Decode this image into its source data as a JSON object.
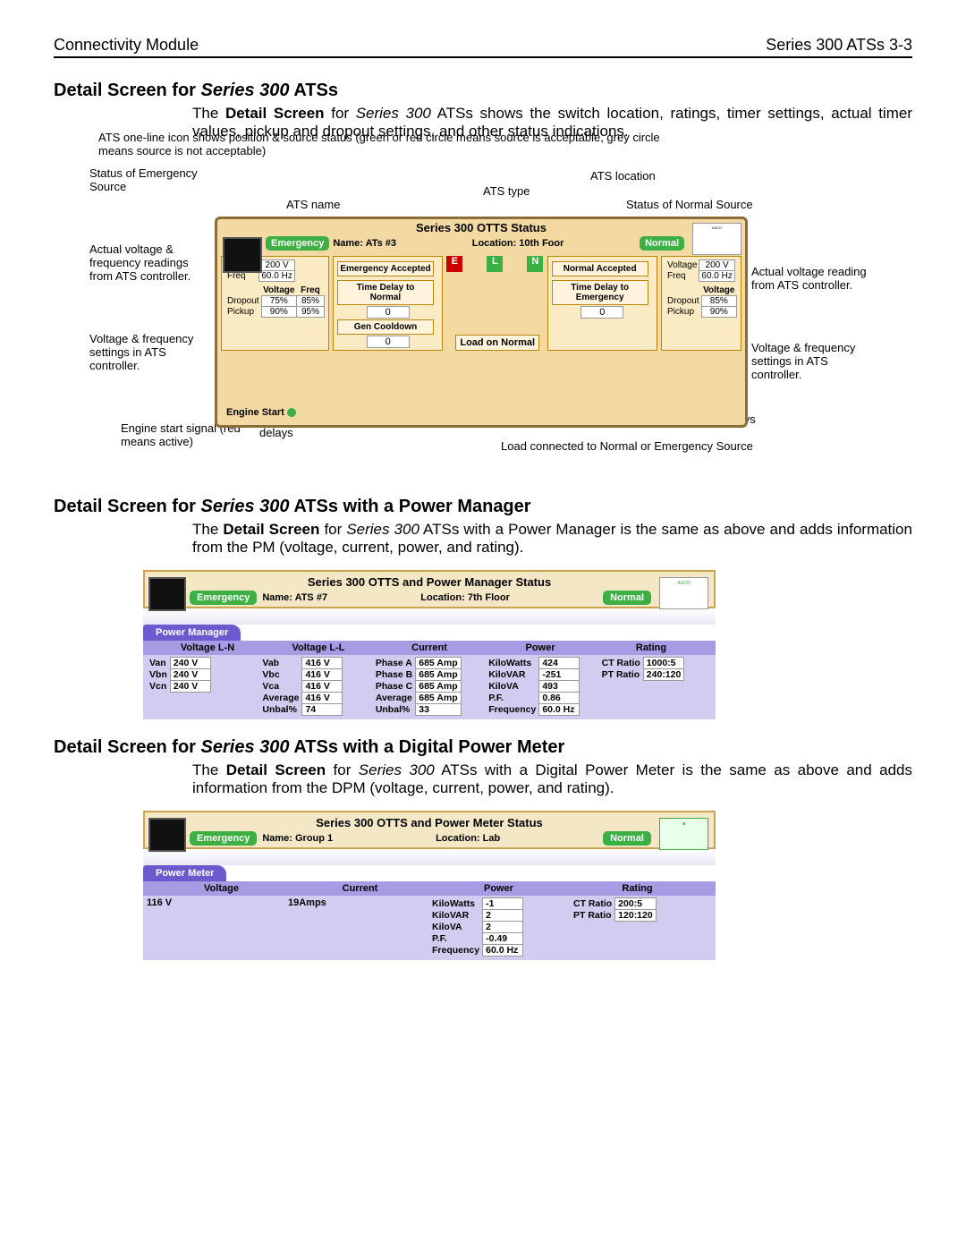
{
  "header": {
    "left": "Connectivity Module",
    "right": "Series 300 ATSs    3-3"
  },
  "section1": {
    "heading_a": "Detail Screen for ",
    "heading_b_ital": "Series 300",
    "heading_c": " ATSs",
    "para_a": "The ",
    "para_b_bold": "Detail Screen",
    "para_c": " for ",
    "para_d_ital": "Series 300",
    "para_e": " ATSs shows the switch location, ratings, timer settings, actual timer values, pickup and dropout settings, and other status indications."
  },
  "fig1": {
    "note_top": "ATS one-line icon shows position & source status (green or red circle means source is acceptable, grey circle means source is not acceptable)",
    "lbl_emergency_status": "Status of Emergency Source",
    "lbl_ats_name": "ATS name",
    "lbl_ats_type": "ATS type",
    "lbl_ats_location": "ATS location",
    "lbl_normal_status": "Status of Normal Source",
    "lbl_actual_vf_left": "Actual voltage & frequency readings from ATS controller.",
    "lbl_actual_vf_right": "Actual voltage reading from ATS controller.",
    "lbl_vf_settings_left": "Voltage & frequency settings in ATS controller.",
    "lbl_vf_settings_right": "Voltage & frequency settings in ATS controller.",
    "lbl_engine_start": "Engine start signal (red means active)",
    "lbl_active_td": "Active time delays",
    "lbl_active_td_right": "Active time delays",
    "lbl_load": "Load connected to Normal or Emergency Source",
    "panel": {
      "title": "Series 300 OTTS Status",
      "name": "Name: ATs #3",
      "location": "Location: 10th Foor",
      "emergency": "Emergency",
      "normal": "Normal",
      "thumb": "ASCO",
      "left_readings": {
        "voltage": "200 V",
        "freq": "60.0 Hz"
      },
      "left_settings_hdr": [
        "Voltage",
        "Freq"
      ],
      "left_settings_rows": [
        [
          "Dropout",
          "75%",
          "85%"
        ],
        [
          "Pickup",
          "90%",
          "95%"
        ]
      ],
      "left_btns": [
        "Emergency Accepted",
        "Time Delay to Normal",
        "Gen Cooldown"
      ],
      "left_btn_vals": [
        "",
        "0",
        "0"
      ],
      "mid": {
        "e": "E",
        "l": "L",
        "n": "N",
        "load": "Load on Normal"
      },
      "right_btns": [
        "Normal Accepted",
        "Time Delay to Emergency"
      ],
      "right_btn_vals": [
        "",
        "0"
      ],
      "right_readings": {
        "voltage": "200 V",
        "freq": "60.0 Hz"
      },
      "right_settings_hdr": [
        "Voltage"
      ],
      "right_settings_rows": [
        [
          "Dropout",
          "85%"
        ],
        [
          "Pickup",
          "90%"
        ]
      ],
      "engine_start": "Engine Start"
    }
  },
  "section2": {
    "heading_a": "Detail Screen for ",
    "heading_b_ital": "Series 300",
    "heading_c": " ATSs with a Power Manager",
    "para_a": "The ",
    "para_b_bold": "Detail Screen",
    "para_c": " for ",
    "para_d_ital": "Series 300",
    "para_e": " ATSs with a Power Manager is the same as above and adds information from the PM (voltage, current, power, and rating)."
  },
  "fig2": {
    "title": "Series 300 OTTS and Power Manager Status",
    "emergency": "Emergency",
    "name": "Name: ATS #7",
    "location": "Location: 7th Floor",
    "normal": "Normal",
    "thumb": "ASCO",
    "tab": "Power Manager",
    "headers": [
      "Voltage L-N",
      "Voltage L-L",
      "Current",
      "Power",
      "Rating"
    ],
    "voltage_ln": [
      [
        "Van",
        "240 V"
      ],
      [
        "Vbn",
        "240 V"
      ],
      [
        "Vcn",
        "240 V"
      ]
    ],
    "voltage_ll": [
      [
        "Vab",
        "416 V"
      ],
      [
        "Vbc",
        "416 V"
      ],
      [
        "Vca",
        "416 V"
      ],
      [
        "Average",
        "416 V"
      ],
      [
        "Unbal%",
        "74"
      ]
    ],
    "current": [
      [
        "Phase A",
        "685 Amp"
      ],
      [
        "Phase B",
        "685 Amp"
      ],
      [
        "Phase C",
        "685 Amp"
      ],
      [
        "Average",
        "685 Amp"
      ],
      [
        "Unbal%",
        "33"
      ]
    ],
    "power": [
      [
        "KiloWatts",
        "424"
      ],
      [
        "KiloVAR",
        "-251"
      ],
      [
        "KiloVA",
        "493"
      ],
      [
        "P.F.",
        "0.86"
      ],
      [
        "Frequency",
        "60.0 Hz"
      ]
    ],
    "rating": [
      [
        "CT Ratio",
        "1000:5"
      ],
      [
        "PT Ratio",
        "240:120"
      ]
    ]
  },
  "section3": {
    "heading_a": "Detail Screen for ",
    "heading_b_ital": "Series 300",
    "heading_c": " ATSs with a Digital Power Meter",
    "para_a": "The ",
    "para_b_bold": "Detail Screen",
    "para_c": " for ",
    "para_d_ital": "Series 300",
    "para_e": " ATSs with a Digital Power Meter is the same as above and adds information from the DPM (voltage, current, power, and rating)."
  },
  "fig3": {
    "title": "Series 300 OTTS and Power Meter Status",
    "emergency": "Emergency",
    "name": "Name: Group 1",
    "location": "Location: Lab",
    "normal": "Normal",
    "tab": "Power Meter",
    "headers": [
      "Voltage",
      "Current",
      "Power",
      "Rating"
    ],
    "voltage": "116 V",
    "current": "19Amps",
    "power": [
      [
        "KiloWatts",
        "-1"
      ],
      [
        "KiloVAR",
        "2"
      ],
      [
        "KiloVA",
        "2"
      ],
      [
        "P.F.",
        "-0.49"
      ],
      [
        "Frequency",
        "60.0 Hz"
      ]
    ],
    "rating": [
      [
        "CT Ratio",
        "200:5"
      ],
      [
        "PT Ratio",
        "120:120"
      ]
    ]
  }
}
